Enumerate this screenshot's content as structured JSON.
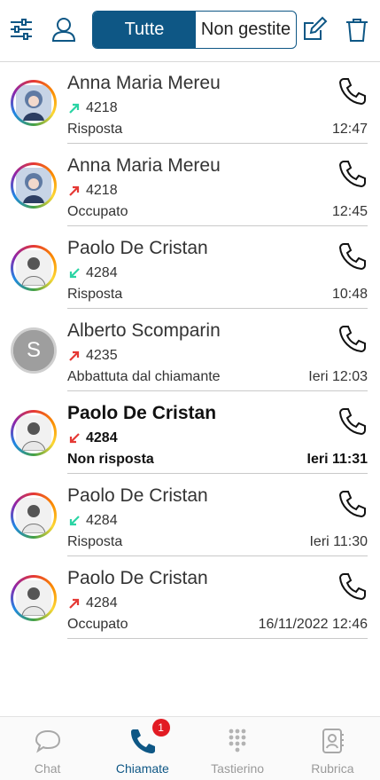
{
  "header": {
    "filter_icon": "filter-sliders-icon",
    "user_icon": "user-icon",
    "tabs": [
      {
        "label": "Tutte",
        "active": true
      },
      {
        "label": "Non gestite",
        "active": false
      }
    ],
    "edit_icon": "edit-icon",
    "trash_icon": "trash-icon",
    "accent_color": "#0e5785"
  },
  "calls": [
    {
      "name": "Anna Maria Mereu",
      "direction": "outgoing",
      "direction_color": "#2bd4a4",
      "extension": "4218",
      "status": "Risposta",
      "time": "12:47",
      "avatar": "anime",
      "missed": false
    },
    {
      "name": "Anna Maria Mereu",
      "direction": "outgoing",
      "direction_color": "#e53935",
      "extension": "4218",
      "status": "Occupato",
      "time": "12:45",
      "avatar": "anime",
      "missed": false
    },
    {
      "name": "Paolo De Cristan",
      "direction": "incoming",
      "direction_color": "#2bd4a4",
      "extension": "4284",
      "status": "Risposta",
      "time": "10:48",
      "avatar": "person",
      "missed": false
    },
    {
      "name": "Alberto Scomparin",
      "direction": "outgoing",
      "direction_color": "#e53935",
      "extension": "4235",
      "status": "Abbattuta dal chiamante",
      "time": "Ieri 12:03",
      "avatar": "letter",
      "initial": "S",
      "missed": false
    },
    {
      "name": "Paolo De Cristan",
      "direction": "incoming",
      "direction_color": "#e53935",
      "extension": "4284",
      "status": "Non risposta",
      "time": "Ieri 11:31",
      "avatar": "person",
      "missed": true
    },
    {
      "name": "Paolo De Cristan",
      "direction": "incoming",
      "direction_color": "#2bd4a4",
      "extension": "4284",
      "status": "Risposta",
      "time": "Ieri 11:30",
      "avatar": "person",
      "missed": false
    },
    {
      "name": "Paolo De Cristan",
      "direction": "outgoing",
      "direction_color": "#e53935",
      "extension": "4284",
      "status": "Occupato",
      "time": "16/11/2022 12:46",
      "avatar": "person",
      "missed": false
    }
  ],
  "nav": {
    "items": [
      {
        "label": "Chat",
        "icon": "chat-bubble-icon",
        "active": false
      },
      {
        "label": "Chiamate",
        "icon": "phone-icon",
        "active": true,
        "badge": "1"
      },
      {
        "label": "Tastierino",
        "icon": "keypad-icon",
        "active": false
      },
      {
        "label": "Rubrica",
        "icon": "contacts-book-icon",
        "active": false
      }
    ]
  }
}
